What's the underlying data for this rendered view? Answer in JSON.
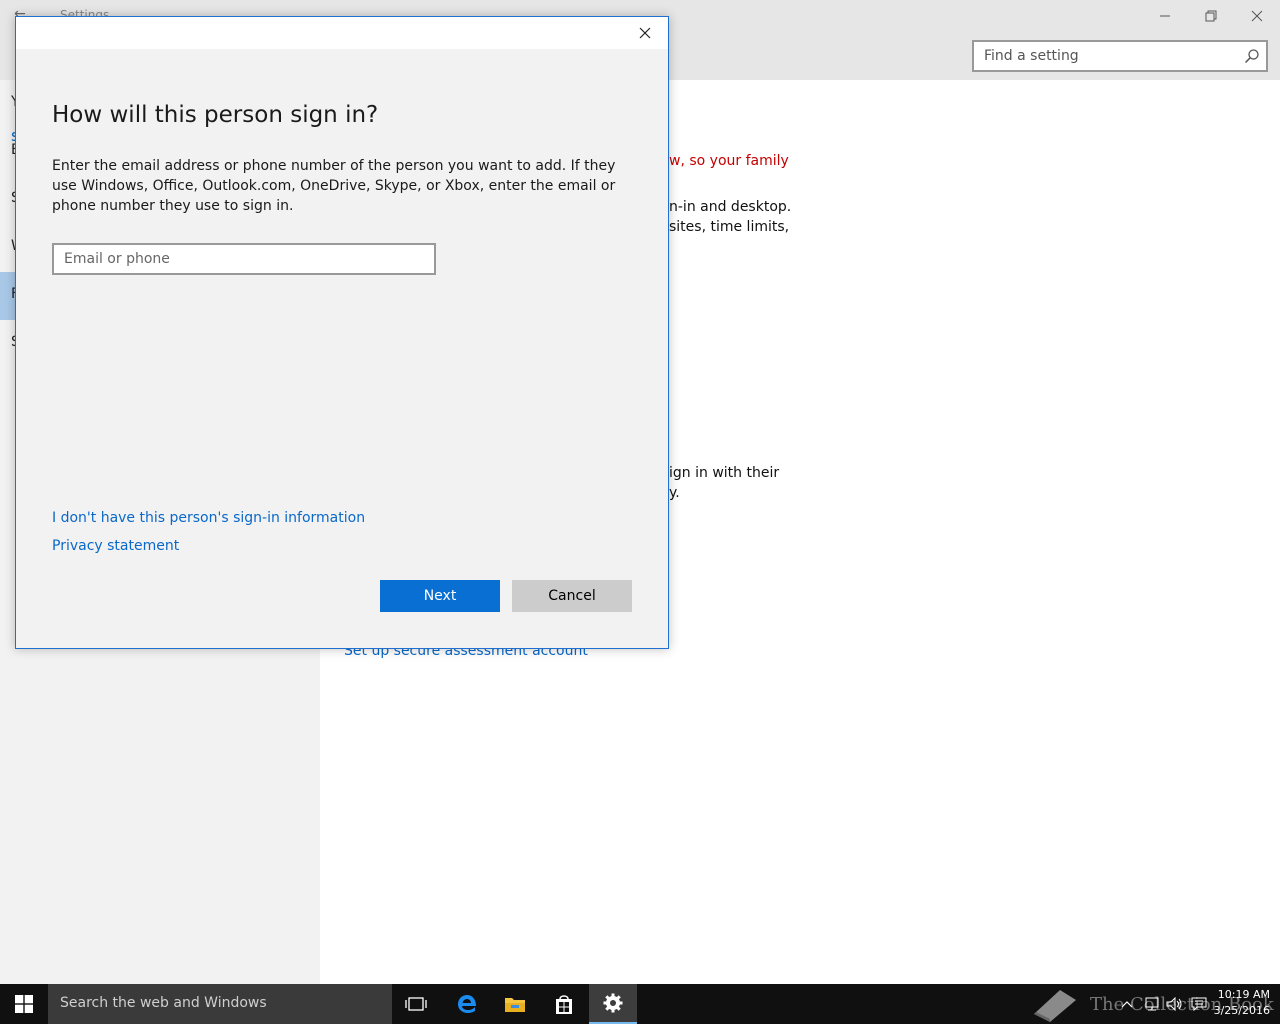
{
  "settings": {
    "title": "Settings",
    "search_placeholder": "Find a setting",
    "sidebar": {
      "accent_fragment": "s",
      "items": [
        {
          "label": "Y"
        },
        {
          "label": "E"
        },
        {
          "label": "S"
        },
        {
          "label": "W"
        },
        {
          "label": "F",
          "selected": true
        },
        {
          "label": "S"
        }
      ]
    },
    "content": {
      "fragments": [
        "w, so your family",
        "n-in and desktop.",
        "sites, time limits,",
        "ign in with their",
        "y."
      ],
      "link": "Set up secure assessment account"
    }
  },
  "dialog": {
    "title": "How will this person sign in?",
    "description": "Enter the email address or phone number of the person you want to add. If they use Windows, Office, Outlook.com, OneDrive, Skype, or Xbox, enter the email or phone number they use to sign in.",
    "email_placeholder": "Email or phone",
    "email_value": "",
    "link_no_info": "I don't have this person's sign-in information",
    "link_privacy": "Privacy statement",
    "next_label": "Next",
    "cancel_label": "Cancel"
  },
  "taskbar": {
    "search_text": "Search the web and Windows",
    "watermark": "The Collection Book",
    "time": "10:19 AM",
    "date": "3/25/2016",
    "icons": [
      "task-view-icon",
      "edge-icon",
      "file-explorer-icon",
      "store-icon",
      "settings-gear-icon"
    ]
  },
  "colors": {
    "accent": "#0a6fd2",
    "link": "#0a68c8",
    "warning_text": "#c50000",
    "selected_sidebar": "#a9c8e8"
  }
}
